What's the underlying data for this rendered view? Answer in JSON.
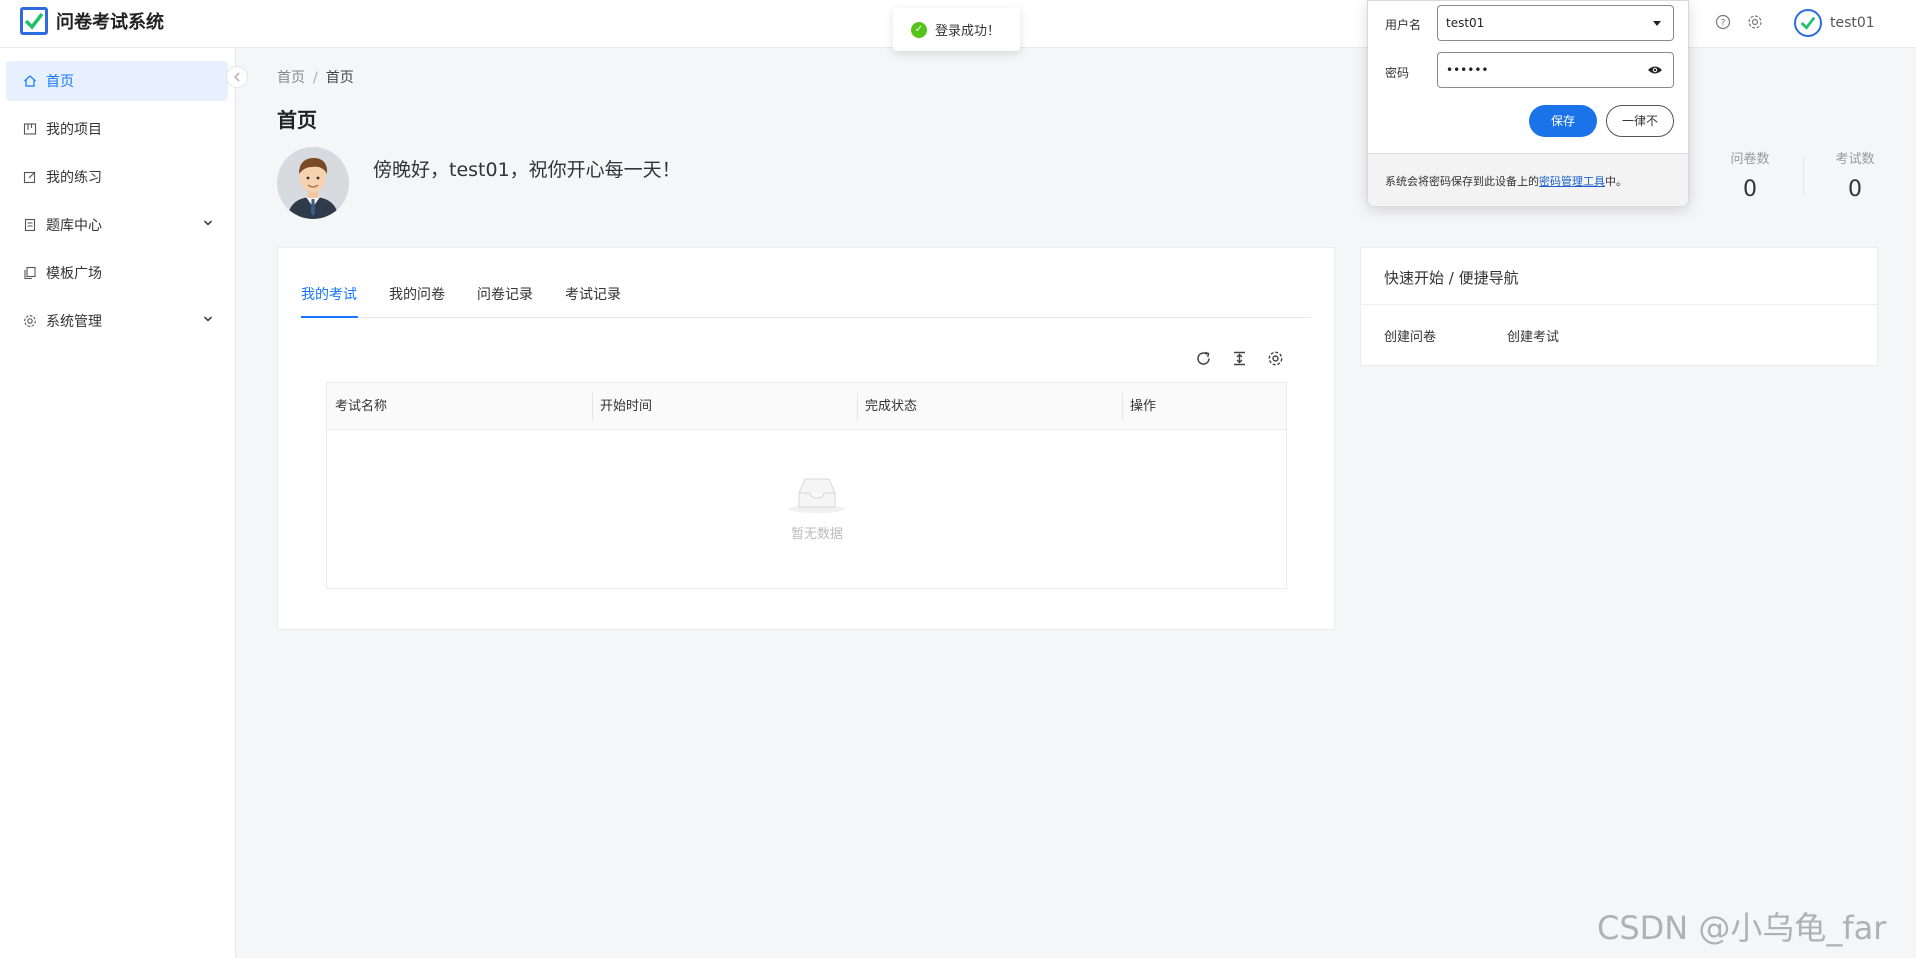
{
  "app": {
    "title": "问卷考试系统"
  },
  "header": {
    "username": "test01"
  },
  "sidebar": {
    "items": [
      {
        "label": "首页"
      },
      {
        "label": "我的项目"
      },
      {
        "label": "我的练习"
      },
      {
        "label": "题库中心"
      },
      {
        "label": "模板广场"
      },
      {
        "label": "系统管理"
      }
    ]
  },
  "breadcrumb": {
    "first": "首页",
    "separator": "/",
    "current": "首页"
  },
  "page": {
    "title": "首页",
    "greeting": "傍晚好，test01，祝你开心每一天！"
  },
  "stats": [
    {
      "label": "问卷数",
      "value": "0"
    },
    {
      "label": "考试数",
      "value": "0"
    }
  ],
  "tabs": [
    {
      "label": "我的考试"
    },
    {
      "label": "我的问卷"
    },
    {
      "label": "问卷记录"
    },
    {
      "label": "考试记录"
    }
  ],
  "table": {
    "columns": [
      "考试名称",
      "开始时间",
      "完成状态",
      "操作"
    ],
    "empty_text": "暂无数据"
  },
  "quick_start": {
    "title": "快速开始 / 便捷导航",
    "links": [
      "创建问卷",
      "创建考试"
    ]
  },
  "toast": {
    "text": "登录成功！"
  },
  "password_popup": {
    "username_label": "用户名",
    "username_value": "test01",
    "password_label": "密码",
    "password_value": "••••••",
    "save_label": "保存",
    "never_label": "一律不",
    "footer_prefix": "系统会将密码保存到此设备上的",
    "footer_link": "密码管理工具",
    "footer_suffix": "中。"
  },
  "watermark": "CSDN @小乌龟_far",
  "colors": {
    "primary": "#1677ff",
    "success": "#52c41a",
    "logo": "#2d6be0"
  }
}
